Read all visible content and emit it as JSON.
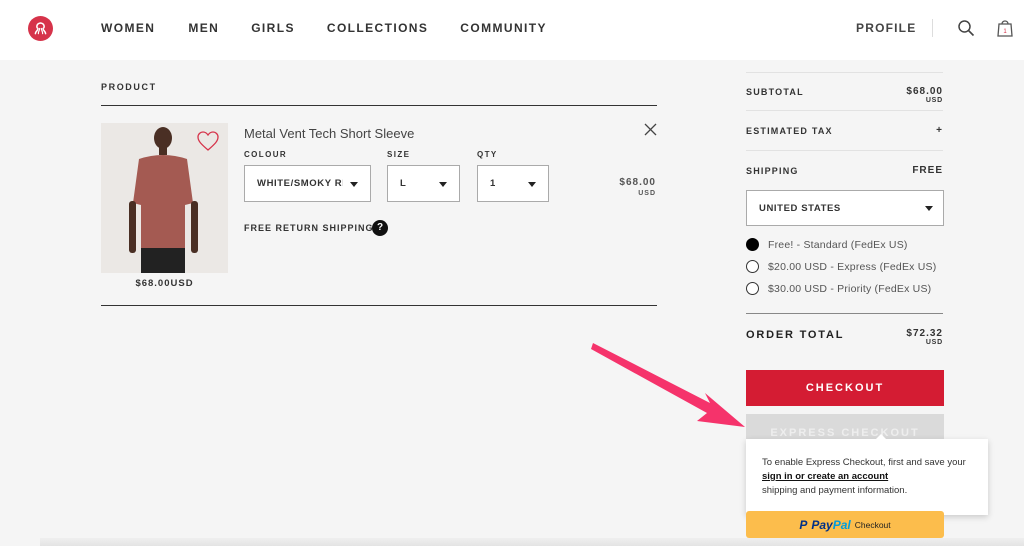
{
  "header": {
    "nav": [
      "WOMEN",
      "MEN",
      "GIRLS",
      "COLLECTIONS",
      "COMMUNITY"
    ],
    "profile_label": "PROFILE",
    "bag_count": "1",
    "brand_color": "#d6334a"
  },
  "cart": {
    "heading": "PRODUCT",
    "item": {
      "name": "Metal Vent Tech Short Sleeve",
      "image_price": "$68.00USD",
      "colour_label": "COLOUR",
      "colour_value": "WHITE/SMOKY RED",
      "size_label": "SIZE",
      "size_value": "L",
      "qty_label": "QTY",
      "qty_value": "1",
      "price": "$68.00",
      "currency": "USD",
      "free_return": "FREE RETURN SHIPPING",
      "help_glyph": "?"
    }
  },
  "summary": {
    "subtotal_label": "SUBTOTAL",
    "subtotal_value": "$68.00",
    "subtotal_currency": "USD",
    "tax_label": "ESTIMATED TAX",
    "tax_value": "+",
    "shipping_label": "SHIPPING",
    "shipping_value": "FREE",
    "country": "UNITED STATES",
    "shipping_options": [
      {
        "label": "Free! - Standard (FedEx US)",
        "selected": true
      },
      {
        "label": "$20.00 USD - Express (FedEx US)",
        "selected": false
      },
      {
        "label": "$30.00 USD - Priority (FedEx US)",
        "selected": false
      }
    ],
    "order_total_label": "ORDER TOTAL",
    "order_total_value": "$72.32",
    "order_total_currency": "USD",
    "checkout_label": "CHECKOUT",
    "express_label": "EXPRESS CHECKOUT",
    "checkout_color": "#d41c33",
    "tooltip": {
      "line1": "To enable Express Checkout, first and save your",
      "link": "sign in or create an account",
      "line3": "shipping and payment information."
    },
    "paypal": {
      "pay": "Pay",
      "pal": "Pal",
      "checkout": "Checkout"
    }
  },
  "annotation": {
    "arrow_color": "#f5336b"
  }
}
